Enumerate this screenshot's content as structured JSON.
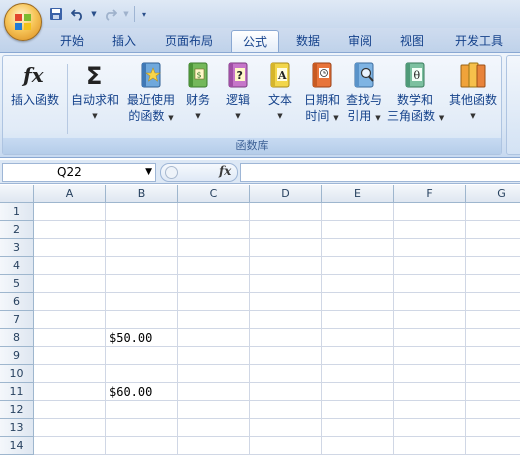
{
  "qat": {
    "save_icon": "save-icon",
    "undo_icon": "undo-icon",
    "redo_icon": "redo-icon",
    "customize_icon": "customize-arrow-icon"
  },
  "tabs": [
    {
      "label": "开始"
    },
    {
      "label": "插入"
    },
    {
      "label": "页面布局"
    },
    {
      "label": "公式"
    },
    {
      "label": "数据"
    },
    {
      "label": "审阅"
    },
    {
      "label": "视图"
    },
    {
      "label": "开发工具"
    }
  ],
  "active_tab": "公式",
  "ribbon": {
    "group_label": "函数库",
    "insert_function": {
      "label": "插入函数",
      "icon": "fx-icon"
    },
    "autosum": {
      "label": "自动求和",
      "icon": "sigma-icon"
    },
    "recent": {
      "line1": "最近使用",
      "line2": "的函数",
      "icon": "star-book-icon"
    },
    "financial": {
      "label": "财务",
      "icon": "finance-book-icon"
    },
    "logical": {
      "label": "逻辑",
      "icon": "question-book-icon"
    },
    "text": {
      "label": "文本",
      "icon": "text-book-icon"
    },
    "datetime": {
      "line1": "日期和",
      "line2": "时间",
      "icon": "clock-book-icon"
    },
    "lookup": {
      "line1": "查找与",
      "line2": "引用",
      "icon": "magnifier-book-icon"
    },
    "math": {
      "line1": "数学和",
      "line2": "三角函数",
      "icon": "theta-book-icon"
    },
    "more": {
      "label": "其他函数",
      "icon": "more-books-icon"
    }
  },
  "formula_bar": {
    "name_box": "Q22",
    "fx_label": "fx",
    "formula": ""
  },
  "columns": [
    "A",
    "B",
    "C",
    "D",
    "E",
    "F",
    "G"
  ],
  "rows": [
    "1",
    "2",
    "3",
    "4",
    "5",
    "6",
    "7",
    "8",
    "9",
    "10",
    "11",
    "12",
    "13",
    "14"
  ],
  "cells": {
    "B8": "$50.00",
    "B11": "$60.00"
  },
  "colors": {
    "ribbon_text": "#15428b",
    "header_bg": "#dfe7f1",
    "gridline": "#d0d7e5"
  }
}
